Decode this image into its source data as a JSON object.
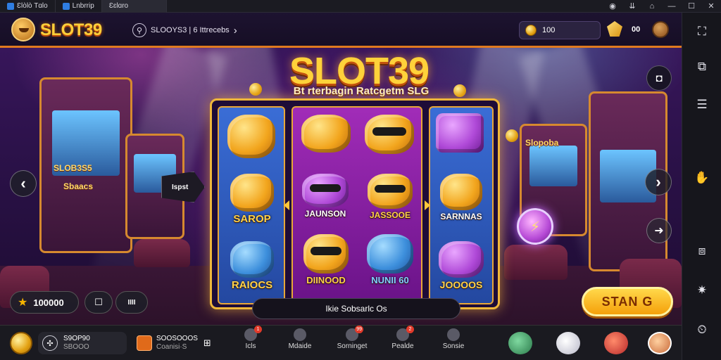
{
  "titlebar": {
    "tabs": [
      {
        "label": "Ɛlòlò Tɑlo",
        "color": "#2f7de1"
      },
      {
        "label": "Lnbrrip",
        "color": "#2f7de1"
      },
      {
        "label": "Ɛɛlɑro",
        "color": "#6b6b78"
      }
    ],
    "controls": [
      "◉",
      "⇊",
      "⌂",
      "—",
      "☐",
      "✕"
    ]
  },
  "header": {
    "logo": "SLOT39",
    "search_text": "SLOOYS3 | 6 Ittrecebs",
    "search_arrow": "›",
    "coins": "100",
    "count": "00"
  },
  "game": {
    "title": "SLOT39",
    "subtitle": "Bt rterbagin Ratcgetm SLG",
    "tag_left": "Ispst",
    "arcade_label_1": "SLOB3S5",
    "arcade_label_2": "Sbaacs",
    "arcade_label_3": "Slopoba",
    "round_button_symbol": "⚡"
  },
  "reels": [
    {
      "label": "",
      "color": "gold"
    },
    {
      "label": "SAROP",
      "color": "gold"
    },
    {
      "label": "RAIOCS",
      "color": "blue"
    },
    {
      "label": "",
      "color": "gold"
    },
    {
      "label": "JAUNSON",
      "color": "purple"
    },
    {
      "label": "DIINOOD",
      "color": "gold"
    },
    {
      "label": "",
      "color": "gold"
    },
    {
      "label": "JASSOOE",
      "color": "gold"
    },
    {
      "label": "NUNII 60",
      "color": "blue"
    },
    {
      "label": "",
      "color": "purple"
    },
    {
      "label": "SARNNAS",
      "color": "gold"
    },
    {
      "label": "JOOOOS",
      "color": "purple"
    }
  ],
  "controls": {
    "balance": "100000",
    "balance_icon": "★",
    "btn_chat": "☐",
    "btn_menu": "IIII",
    "info_text": "Ikie Sobsarlc Os",
    "spin_label": "STAN G"
  },
  "bottombar": {
    "wallet_value": "S9OP90",
    "wallet_sub": "SBOOO",
    "mid_value": "SOOSOOOS",
    "mid_sub": "Coanisi·S",
    "mid_icon_text": "⊞",
    "nav": [
      {
        "label": "Icls",
        "badge": "1"
      },
      {
        "label": "Mdaide",
        "badge": ""
      },
      {
        "label": "Sorninget",
        "badge": "99"
      },
      {
        "label": "Pealde",
        "badge": "2"
      },
      {
        "label": "Sonsie",
        "badge": ""
      }
    ]
  },
  "sidebar_icons": [
    "⛶",
    "⧉",
    "☰",
    "✋",
    "⧈",
    "✷",
    "⏲"
  ]
}
